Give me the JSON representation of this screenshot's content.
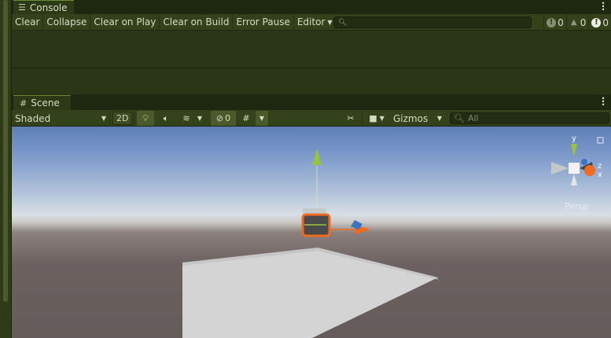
{
  "console": {
    "tab_label": "Console",
    "toolbar": {
      "clear": "Clear",
      "collapse": "Collapse",
      "clear_on_play": "Clear on Play",
      "clear_on_build": "Clear on Build",
      "error_pause": "Error Pause",
      "editor": "Editor"
    },
    "search_placeholder": "",
    "counts": {
      "info": "0",
      "warnings": "0",
      "errors": "0"
    }
  },
  "scene": {
    "tab_label": "Scene",
    "toolbar": {
      "draw_mode": "Shaded",
      "mode_2d": "2D",
      "hidden_count": "0",
      "gizmos": "Gizmos",
      "search_placeholder": "All"
    },
    "view": {
      "projection_label": "Persp",
      "axis_x": "x",
      "axis_y": "y",
      "axis_z": "z"
    }
  },
  "colors": {
    "panel": "#2a3616",
    "toolbar": "#34421c",
    "selection_outline": "#f06a1f",
    "gizmo_y": "#9ac23c",
    "gizmo_x": "#f06a1f",
    "gizmo_z": "#3a75c4"
  },
  "icons": {
    "console_tab": "console-list-icon",
    "scene_tab": "scene-grid-icon",
    "search": "search-icon",
    "lighting": "lightbulb-icon",
    "audio": "speaker-icon",
    "effects": "effects-icon",
    "visibility": "eye-slash-icon",
    "grid": "grid-icon",
    "tools": "tools-icon",
    "camera": "camera-icon"
  }
}
